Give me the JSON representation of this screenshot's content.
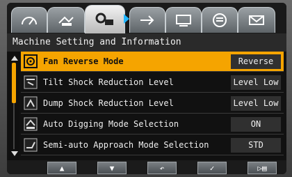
{
  "tabs": [
    {
      "icon": "gauge-icon"
    },
    {
      "icon": "hand-settings-icon"
    },
    {
      "icon": "machine-settings-icon",
      "active": true
    },
    {
      "icon": "arrow-icon"
    },
    {
      "icon": "monitor-icon"
    },
    {
      "icon": "list-icon"
    },
    {
      "icon": "mail-icon"
    }
  ],
  "title": "Machine Setting and Information",
  "accent_color": "#f5a400",
  "items": [
    {
      "label": "Fan Reverse Mode",
      "value": "Reverse",
      "icon": "fan-icon",
      "selected": true
    },
    {
      "label": "Tilt Shock Reduction Level",
      "value": "Level Low",
      "icon": "tilt-icon"
    },
    {
      "label": "Dump Shock Reduction Level",
      "value": "Level Low",
      "icon": "dump-icon"
    },
    {
      "label": "Auto Digging Mode Selection",
      "value": "ON",
      "icon": "auto-dig-icon"
    },
    {
      "label": "Semi-auto Approach Mode Selection",
      "value": "STD",
      "icon": "approach-icon"
    }
  ],
  "bottom": [
    {
      "icon": "up-arrow-icon",
      "symbol": "▲"
    },
    {
      "icon": "down-arrow-icon",
      "symbol": "▼"
    },
    {
      "icon": "return-icon",
      "symbol": "↶"
    },
    {
      "icon": "check-icon",
      "symbol": "✓"
    },
    {
      "icon": "play-list-icon",
      "symbol": "▷▤"
    }
  ]
}
